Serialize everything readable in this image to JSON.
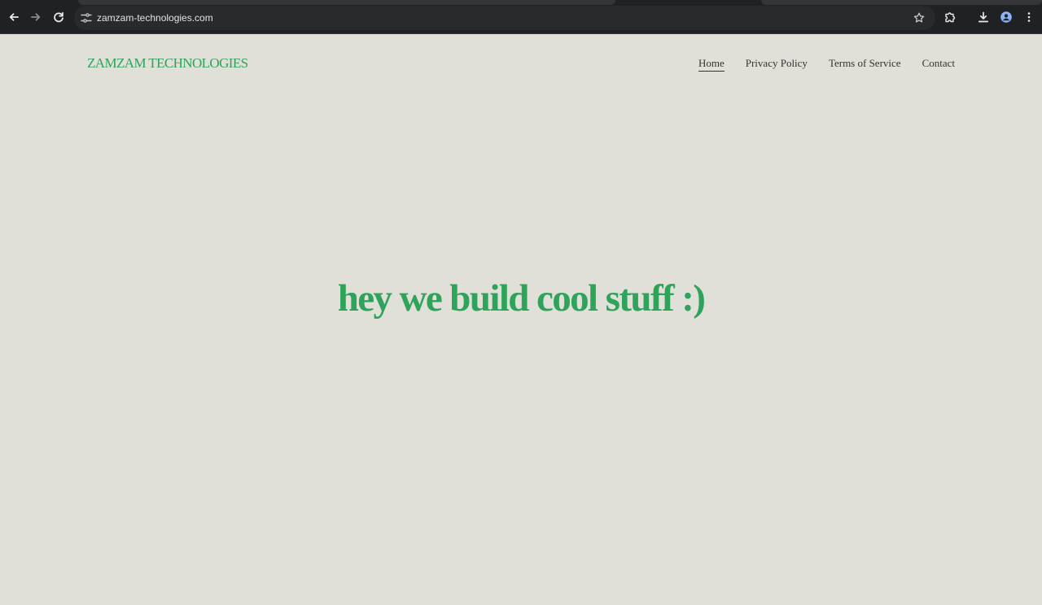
{
  "browser": {
    "url": "zamzam-technologies.com"
  },
  "site": {
    "brand": "ZAMZAM TECHNOLOGIES",
    "nav": [
      {
        "label": "Home",
        "active": true
      },
      {
        "label": "Privacy Policy"
      },
      {
        "label": "Terms of Service"
      },
      {
        "label": "Contact"
      }
    ],
    "hero_text": "hey we build cool stuff :)"
  },
  "icons": {
    "back": "arrow-left-icon",
    "forward": "arrow-right-icon",
    "reload": "reload-icon",
    "site_info": "tune-icon",
    "bookmark": "star-icon",
    "extensions": "puzzle-icon",
    "downloads": "download-icon",
    "profile": "profile-icon",
    "menu": "more-vert-icon"
  },
  "colors": {
    "accent": "#2ea35a",
    "page_background": "#e0dfd8",
    "browser_background": "#202124"
  }
}
